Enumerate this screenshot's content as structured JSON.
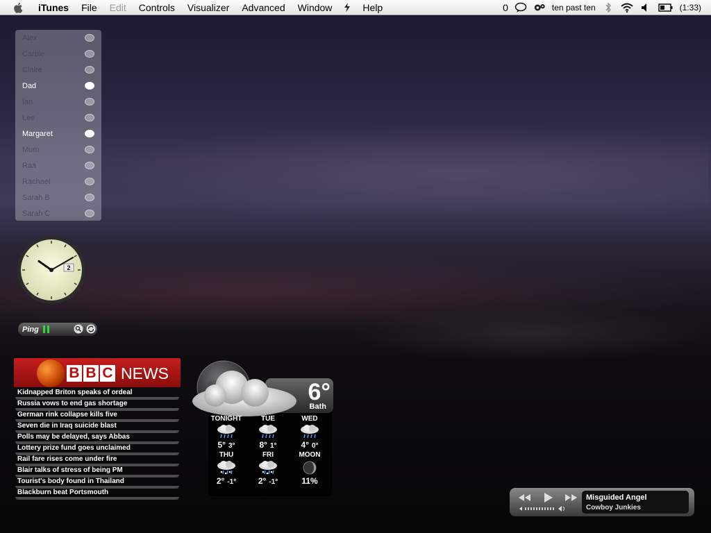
{
  "menubar": {
    "app_name": "iTunes",
    "items": [
      "File",
      "Edit",
      "Controls",
      "Visualizer",
      "Advanced",
      "Window",
      "Help"
    ],
    "disabled_item": "Edit",
    "status": {
      "message_count": "0",
      "fuzzy_time": "ten past ten",
      "battery": "(1:33)"
    }
  },
  "buddies": [
    {
      "name": "Alex",
      "active": false
    },
    {
      "name": "Carole",
      "active": false
    },
    {
      "name": "Claire",
      "active": false
    },
    {
      "name": "Dad",
      "active": true
    },
    {
      "name": "Ian",
      "active": false
    },
    {
      "name": "Lee",
      "active": false
    },
    {
      "name": "Margaret",
      "active": true
    },
    {
      "name": "Mum",
      "active": false
    },
    {
      "name": "Raa",
      "active": false
    },
    {
      "name": "Rachael",
      "active": false
    },
    {
      "name": "Sarah B",
      "active": false
    },
    {
      "name": "Sarah C",
      "active": false
    }
  ],
  "clock": {
    "date": "2",
    "hour": 10,
    "minute": 10
  },
  "ping": {
    "label": "Ping"
  },
  "bbc": {
    "logo_letters": [
      "B",
      "B",
      "C"
    ],
    "logo_word": "NEWS",
    "headlines": [
      "Kidnapped Briton speaks of ordeal",
      "Russia vows to end gas shortage",
      "German rink collapse kills five",
      "Seven die in Iraq suicide blast",
      "Polls may be delayed, says Abbas",
      "Lottery prize fund goes unclaimed",
      "Rail fare rises come under fire",
      "Blair talks of stress of being PM",
      "Tourist's body found in Thailand",
      "Blackburn beat Portsmouth"
    ]
  },
  "weather": {
    "current_temp": "6°",
    "city": "Bath",
    "rows": [
      [
        {
          "day": "TONIGHT",
          "icon": "rain-icon",
          "high": "5°",
          "low": "3°"
        },
        {
          "day": "TUE",
          "icon": "rain-icon",
          "high": "8°",
          "low": "1°"
        },
        {
          "day": "WED",
          "icon": "rain-icon",
          "high": "4°",
          "low": "0°"
        }
      ],
      [
        {
          "day": "THU",
          "icon": "sleet-icon",
          "high": "2°",
          "low": "-1°"
        },
        {
          "day": "FRI",
          "icon": "sleet-icon",
          "high": "2°",
          "low": "-1°"
        },
        {
          "day": "MOON",
          "icon": "moon-icon",
          "high": "11%",
          "low": ""
        }
      ]
    ]
  },
  "itunes": {
    "song": "Misguided Angel",
    "artist": "Cowboy Junkies"
  }
}
